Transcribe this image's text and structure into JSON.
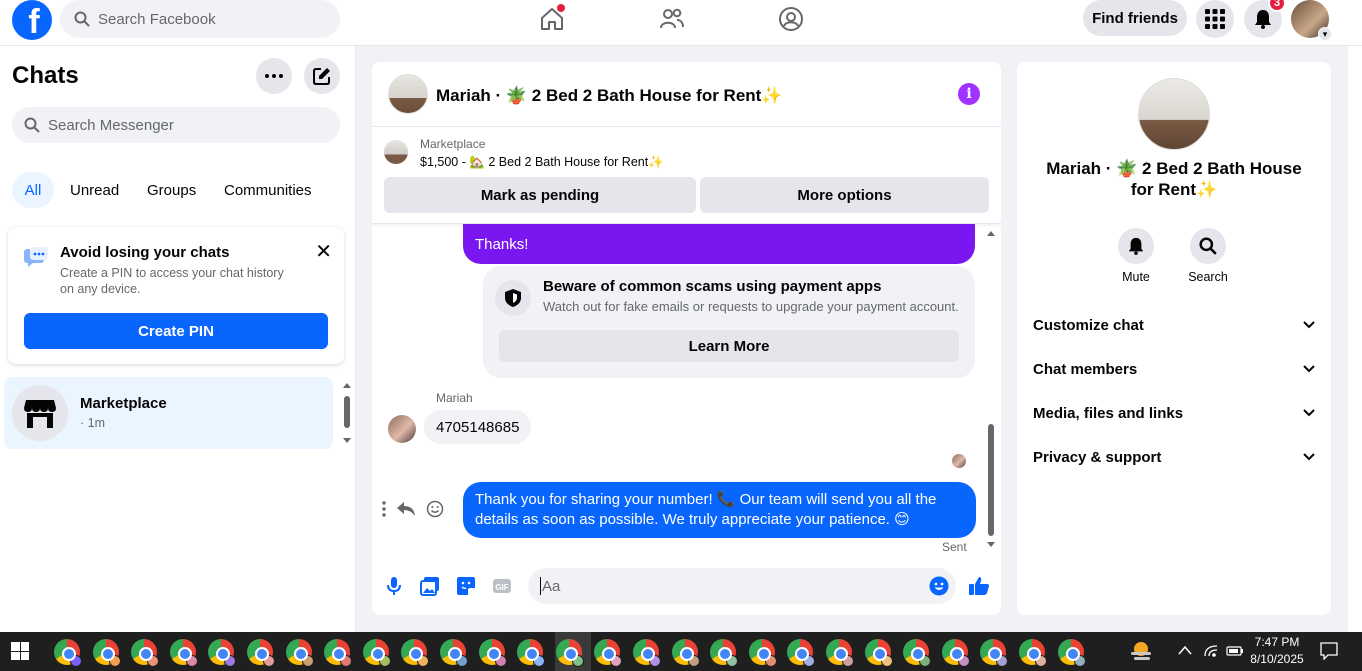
{
  "topbar": {
    "search_placeholder": "Search Facebook",
    "find_friends": "Find friends",
    "notifications_count": "3"
  },
  "sidebar": {
    "title": "Chats",
    "search_placeholder": "Search Messenger",
    "filters": [
      "All",
      "Unread",
      "Groups",
      "Communities"
    ],
    "pin_card": {
      "title": "Avoid losing your chats",
      "text": "Create a PIN to access your chat history on any device.",
      "button": "Create PIN"
    },
    "conversations": [
      {
        "name": "Marketplace",
        "time": "· 1m"
      }
    ]
  },
  "chat": {
    "title": "Mariah · 🪴 2 Bed 2 Bath House for Rent✨",
    "marketplace": {
      "label": "Marketplace",
      "price_line": "$1,500 - 🏡 2 Bed 2 Bath House for Rent✨",
      "mark_pending": "Mark as pending",
      "more_options": "More options"
    },
    "messages": {
      "thanks": "Thanks!",
      "scam_title": "Beware of common scams using payment apps",
      "scam_text": "Watch out for fake emails or requests to upgrade your payment account.",
      "learn_more": "Learn More",
      "sender_name": "Mariah",
      "incoming": "4705148685",
      "outgoing": "Thank you for sharing your number! 📞 Our team will send you all the details as soon as possible. We truly appreciate your patience. 😊",
      "status": "Sent"
    },
    "composer_placeholder": "Aa"
  },
  "details": {
    "title": "Mariah · 🪴 2 Bed 2 Bath House for Rent✨",
    "actions": [
      "Mute",
      "Search"
    ],
    "sections": [
      "Customize chat",
      "Chat members",
      "Media, files and links",
      "Privacy & support"
    ]
  },
  "taskbar": {
    "time": "7:47 PM",
    "date": "8/10/2025"
  },
  "colors": {
    "accent": "#0866ff",
    "purple": "#7a16f0",
    "info": "#a033ff"
  }
}
